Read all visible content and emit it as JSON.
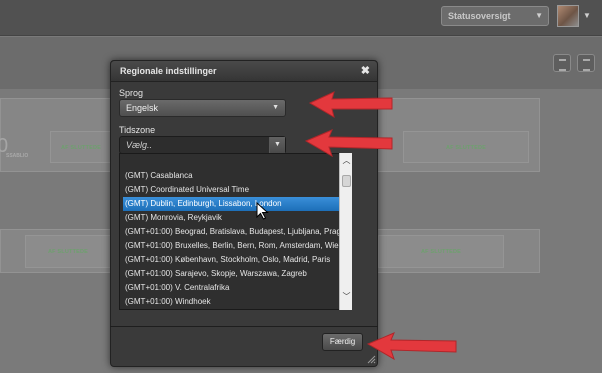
{
  "topbar": {
    "status_select_value": "Statusoversigt"
  },
  "background": {
    "big_number": "0",
    "card_sub_label": "SSABLIO",
    "card_labels": [
      "AF SLUTTEDE",
      "AF SLUTTEDE",
      "AF SLUTTEDE",
      "AF SLUTTEDE"
    ],
    "card_badge": "AF SLUTTEDE"
  },
  "modal": {
    "title": "Regionale indstillinger",
    "close_glyph": "✖",
    "language_label": "Sprog",
    "language_value": "Engelsk",
    "timezone_label": "Tidszone",
    "timezone_placeholder": "Vælg..",
    "timezone_options": [
      {
        "label": "",
        "selected": false
      },
      {
        "label": "(GMT) Casablanca",
        "selected": false
      },
      {
        "label": "(GMT) Coordinated Universal Time",
        "selected": false
      },
      {
        "label": "(GMT) Dublin, Edinburgh, Lissabon, London",
        "selected": true
      },
      {
        "label": "(GMT) Monrovia, Reykjavik",
        "selected": false
      },
      {
        "label": "(GMT+01:00) Beograd, Bratislava, Budapest, Ljubljana, Prag",
        "selected": false
      },
      {
        "label": "(GMT+01:00) Bruxelles, Berlin, Bern, Rom, Amsterdam, Wien",
        "selected": false
      },
      {
        "label": "(GMT+01:00) København, Stockholm, Oslo, Madrid, Paris",
        "selected": false
      },
      {
        "label": "(GMT+01:00) Sarajevo, Skopje, Warszawa, Zagreb",
        "selected": false
      },
      {
        "label": "(GMT+01:00) V. Centralafrika",
        "selected": false
      },
      {
        "label": "(GMT+01:00) Windhoek",
        "selected": false
      }
    ],
    "done_label": "Færdig"
  },
  "colors": {
    "accent_arrow": "#e3383d",
    "selection": "#1d6fb8"
  }
}
